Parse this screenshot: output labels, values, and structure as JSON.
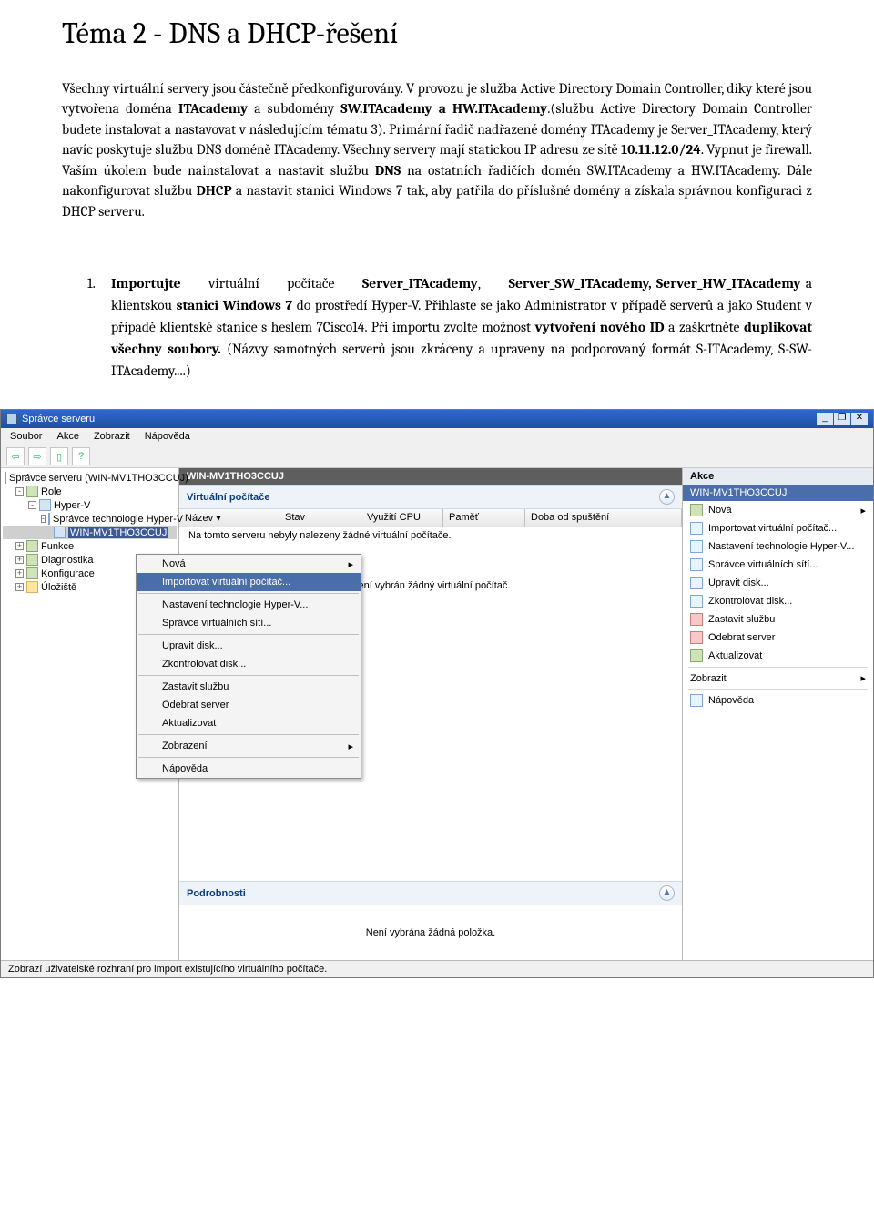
{
  "doc": {
    "title": "Téma 2 - DNS a DHCP-řešení",
    "intro_1": "Všechny virtuální servery jsou částečně předkonfigurovány. V provozu je služba Active Directory Domain Controller, díky které jsou vytvořena doména ",
    "b1": "ITAcademy",
    "intro_2": " a subdomény ",
    "b2": "SW.ITAcademy a HW.ITAcademy",
    "intro_3": ".(službu Active Directory Domain Controller budete instalovat a nastavovat v následujícím tématu 3). Primární řadič nadřazené domény ITAcademy je Server_ITAcademy, který navíc poskytuje službu DNS doméně ITAcademy. Všechny servery mají statickou IP adresu ze sítě ",
    "b3": "10.11.12.0/24",
    "intro_4": ". Vypnut je firewall. Vaším úkolem bude nainstalovat a nastavit službu ",
    "b4": "DNS",
    "intro_5": " na ostatních řadičích domén SW.ITAcademy a HW.ITAcademy. Dále nakonfigurovat službu ",
    "b5": "DHCP",
    "intro_6": " a nastavit stanici Windows 7 tak, aby patřila do příslušné domény a získala správnou konfiguraci z DHCP serveru.",
    "step_num": "1.",
    "s1a": "Importujte",
    "s1b": "virtuální",
    "s1c": "počítače",
    "s1d": "Server_ITAcademy",
    "s1e": ",",
    "s1f": "Server_SW_ITAcademy, Server_HW_ITAcademy",
    "s1g": " a klientskou ",
    "s1h": "stanici Windows 7",
    "s1i": " do prostředí Hyper-V. ",
    "s1j": "Přihlaste se jako Administrator v případě serverů a jako Student v případě klientské stanice s heslem 7Cisco14. Při importu zvolte možnost ",
    "s1k": "vytvoření nového ID",
    "s1l": " a zaškrtněte ",
    "s1m": "duplikovat všechny soubory.",
    "s1n": " (Názvy samotných serverů jsou zkráceny a upraveny na podporovaný formát S-ITAcademy, S-SW-ITAcademy....)"
  },
  "app": {
    "title": "Správce serveru",
    "menus": [
      "Soubor",
      "Akce",
      "Zobrazit",
      "Nápověda"
    ],
    "tree": {
      "root": "Správce serveru (WIN-MV1THO3CCUJ)",
      "role": "Role",
      "hyperv": "Hyper-V",
      "tech": "Správce technologie Hyper-V",
      "node": "WIN-MV1THO3CCUJ",
      "funkce": "Funkce",
      "diag": "Diagnostika",
      "konf": "Konfigurace",
      "uloz": "Úložiště"
    },
    "ctx": {
      "nova": "Nová",
      "import": "Importovat virtuální počítač...",
      "nastaveni": "Nastavení technologie Hyper-V...",
      "spravce": "Správce virtuálních sítí...",
      "upravit": "Upravit disk...",
      "zkontrol": "Zkontrolovat disk...",
      "zastavit": "Zastavit službu",
      "odebrat": "Odebrat server",
      "aktual": "Aktualizovat",
      "zobraz": "Zobrazení",
      "napoveda": "Nápověda"
    },
    "center": {
      "header": "WIN-MV1THO3CCUJ",
      "sub1": "Virtuální počítače",
      "cols": [
        "Název ▾",
        "Stav",
        "Využití CPU",
        "Paměť",
        "Doba od spuštění"
      ],
      "empty": "Na tomto serveru nebyly nalezeny žádné virtuální počítače.",
      "nosel": "Není vybrán žádný virtuální počítač.",
      "details": "Podrobnosti",
      "noitem": "Není vybrána žádná položka."
    },
    "right": {
      "head": "Akce",
      "title": "WIN-MV1THO3CCUJ",
      "items": [
        "Nová",
        "Importovat virtuální počítač...",
        "Nastavení technologie Hyper-V...",
        "Správce virtuálních sítí...",
        "Upravit disk...",
        "Zkontrolovat disk...",
        "Zastavit službu",
        "Odebrat server",
        "Aktualizovat",
        "Zobrazit",
        "Nápověda"
      ]
    },
    "status": "Zobrazí uživatelské rozhraní pro import existujícího virtuálního počítače."
  }
}
